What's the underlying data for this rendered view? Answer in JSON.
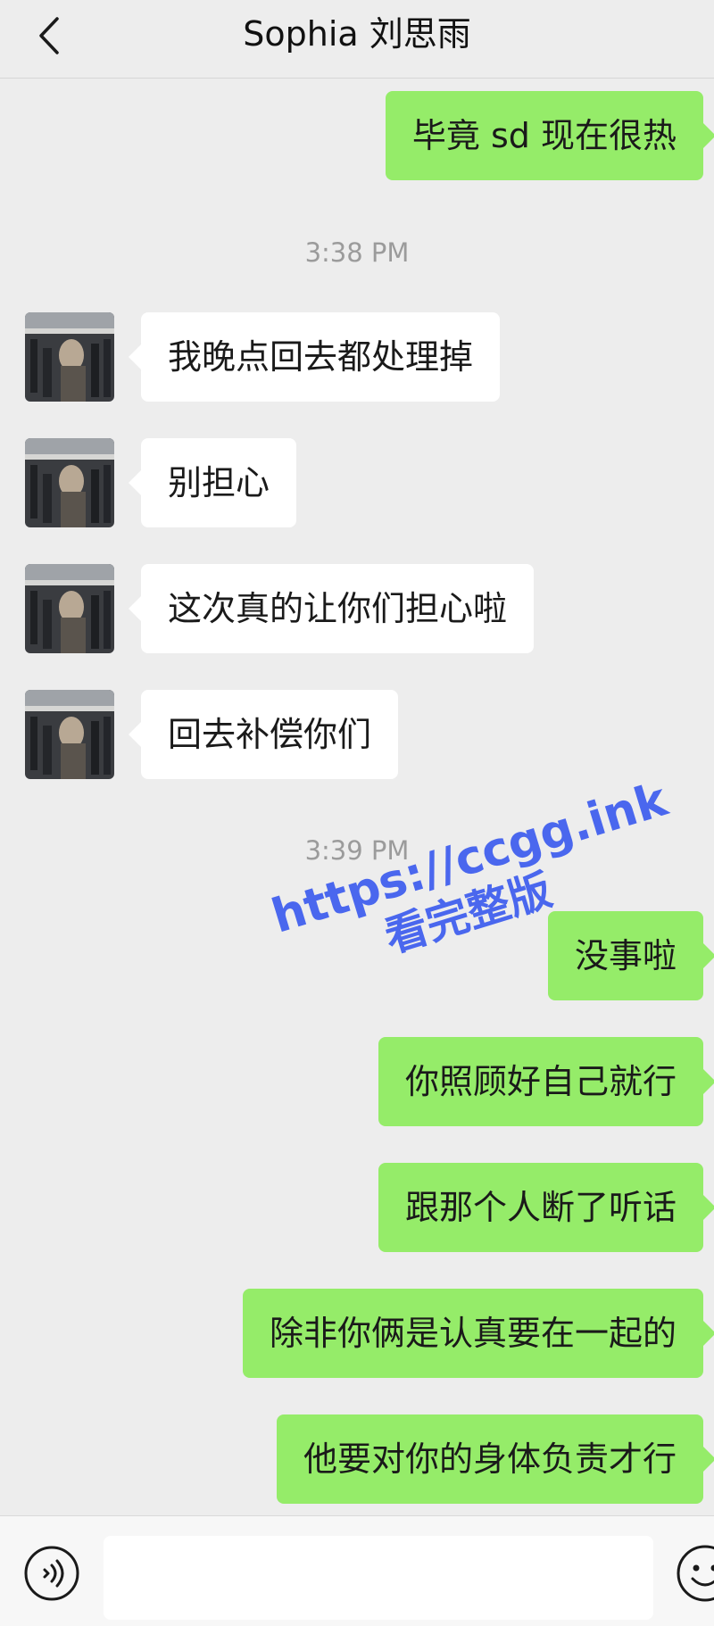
{
  "header": {
    "title": "Sophia 刘思雨"
  },
  "messages": [
    {
      "side": "out",
      "text": "毕竟 sd 现在很热"
    },
    {
      "side": "time",
      "text": "3:38 PM"
    },
    {
      "side": "in",
      "text": "我晚点回去都处理掉"
    },
    {
      "side": "in",
      "text": "别担心"
    },
    {
      "side": "in",
      "text": "这次真的让你们担心啦"
    },
    {
      "side": "in",
      "text": "回去补偿你们"
    },
    {
      "side": "time",
      "text": "3:39 PM"
    },
    {
      "side": "out",
      "text": "没事啦"
    },
    {
      "side": "out",
      "text": "你照顾好自己就行"
    },
    {
      "side": "out",
      "text": "跟那个人断了听话"
    },
    {
      "side": "out",
      "text": "除非你俩是认真要在一起的"
    },
    {
      "side": "out",
      "text": "他要对你的身体负责才行"
    }
  ],
  "watermark": {
    "line1": "https://ccgg.ink",
    "line2": "看完整版"
  },
  "input": {
    "value": ""
  },
  "icons": {
    "back": "chevron-left-icon",
    "voice": "voice-icon",
    "emoji": "emoji-icon"
  },
  "colors": {
    "background": "#ededed",
    "outgoing_bubble": "#95ec69",
    "incoming_bubble": "#ffffff",
    "watermark": "#4a67ee"
  }
}
